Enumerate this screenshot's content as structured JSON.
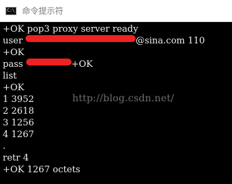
{
  "window": {
    "title": "命令提示符",
    "icon": "cmd-icon",
    "icon_glyph": "C:\\"
  },
  "console": {
    "line1": "+OK pop3 proxy server ready",
    "line2_prefix": "user",
    "line2_suffix": "@sina.com 110",
    "line3": "+OK",
    "line4_prefix": "pass",
    "line4_suffix": "+OK",
    "line5": "list",
    "line6": "+OK",
    "line7": "1 3952",
    "line8": "2 2618",
    "line9": "3 1256",
    "line10": "4 1267",
    "line11": ".",
    "line12": "retr 4",
    "line13": "+OK 1267 octets"
  },
  "watermark": {
    "text": "http://blog.csdn.net/"
  },
  "colors": {
    "console_bg": "#000000",
    "console_text": "#f0f0f0",
    "redaction": "#ee2222",
    "titlebar_bg": "#ffffff"
  }
}
